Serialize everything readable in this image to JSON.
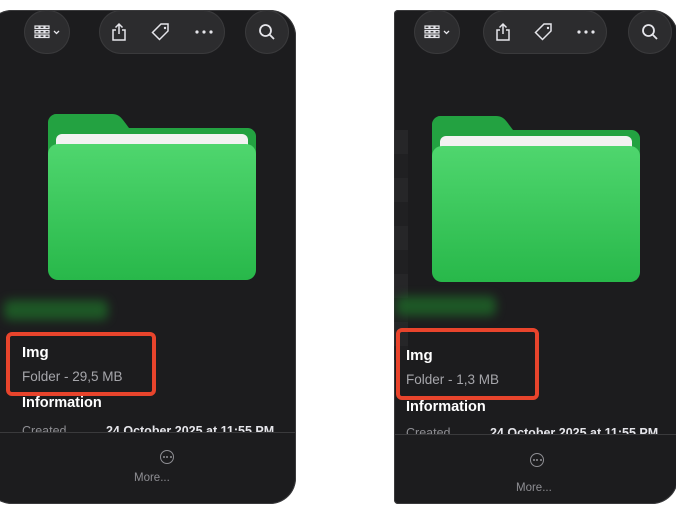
{
  "panels": [
    {
      "file_name": "Img",
      "subtitle": "Folder - 29,5 MB",
      "section_title": "Information",
      "meta_label": "Created",
      "meta_value": "24 October 2025 at 11:55 PM",
      "more_label": "More..."
    },
    {
      "file_name": "Img",
      "subtitle": "Folder - 1,3 MB",
      "section_title": "Information",
      "meta_label": "Created",
      "meta_value": "24 October 2025 at 11:55 PM",
      "more_label": "More..."
    }
  ],
  "icons": {
    "view": "grid-view-icon",
    "share": "share-icon",
    "tag": "tag-icon",
    "more": "ellipsis-icon",
    "search": "search-icon",
    "folder": "folder-icon"
  },
  "colors": {
    "panel_background": "#1c1c1e",
    "highlight_box": "#e8442c",
    "folder_green": "#34c759"
  }
}
